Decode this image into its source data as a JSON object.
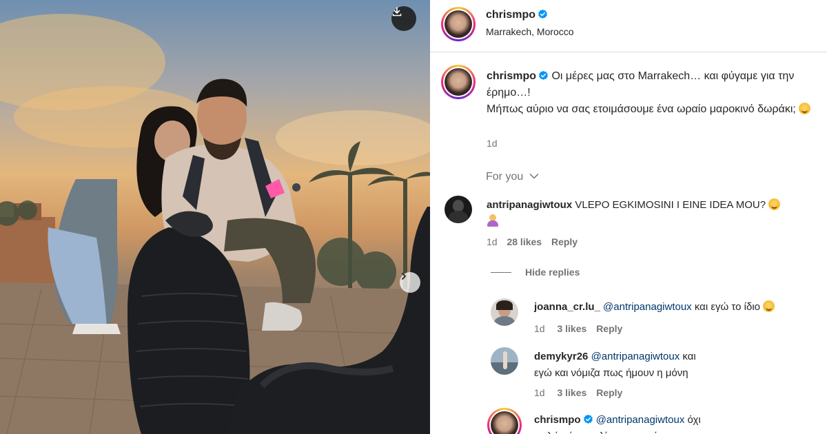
{
  "post": {
    "username": "chrismpo",
    "location": "Marrakech, Morocco"
  },
  "caption": {
    "username": "chrismpo",
    "line1": "Οι μέρες μας στο Marrakech… και φύγαμε για την έρημο…!",
    "line2": "Μήπως αύριο να σας ετοιμάσουμε ένα ωραίο μαροκινό δωράκι;",
    "age": "1d"
  },
  "sort": {
    "label": "For you"
  },
  "comments": [
    {
      "username": "antripanagiwtoux",
      "text": "VLEPO EGKIMOSINI I EINE IDEA MOU?",
      "age": "1d",
      "likes": "28 likes",
      "reply": "Reply",
      "hide_replies": "Hide replies",
      "replies": [
        {
          "username": "joanna_cr.lu_",
          "mention": "@antripanagiwtoux",
          "text": "και εγώ το ίδιο",
          "age": "1d",
          "likes": "3 likes",
          "reply": "Reply"
        },
        {
          "username": "demykyr26",
          "mention": "@antripanagiwtoux",
          "text": "και εγώ και νόμιζα πως ήμουν η μόνη",
          "age": "1d",
          "likes": "3 likes",
          "reply": "Reply"
        },
        {
          "username": "chrismpo",
          "mention": "@antripanagiwtoux",
          "text": "όχι απλώς έφαγα λίγο παραπάνω"
        }
      ]
    }
  ],
  "colors": {
    "verified": "#0095f6",
    "mention": "#00376b",
    "muted": "#737373",
    "text": "#262626"
  },
  "icons": {
    "download": "download-icon",
    "next": "chevron-right-icon",
    "verified": "verified-badge-icon",
    "sort": "chevron-down-icon"
  }
}
